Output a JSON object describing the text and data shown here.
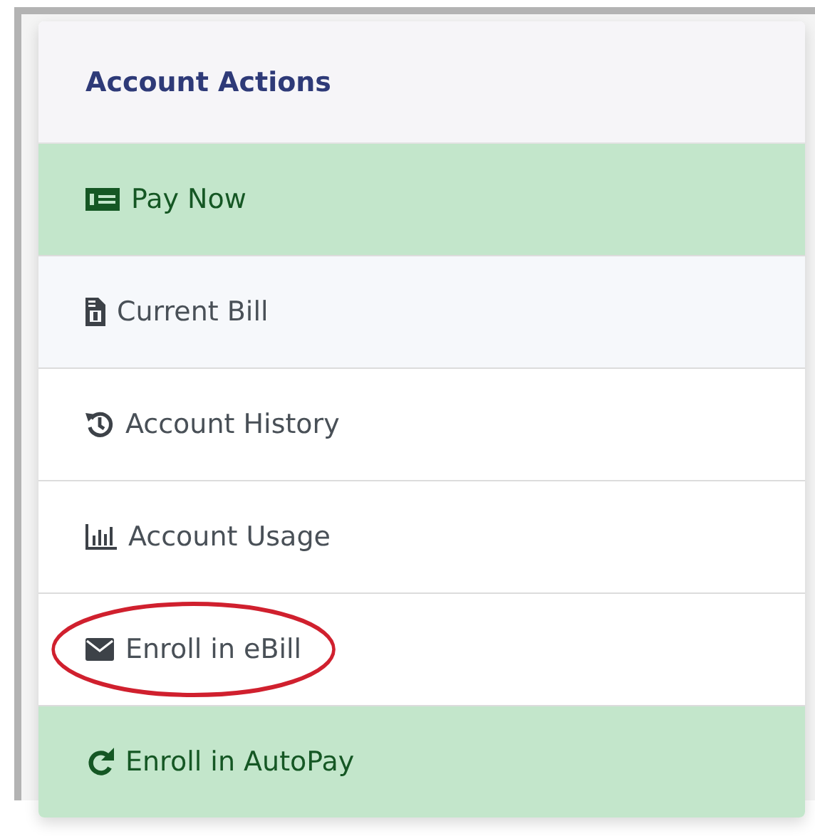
{
  "card": {
    "title": "Account Actions"
  },
  "items": [
    {
      "label": "Pay Now",
      "kind": "success",
      "circled": false
    },
    {
      "label": "Current Bill",
      "kind": "light",
      "circled": false
    },
    {
      "label": "Account History",
      "kind": "plain",
      "circled": false
    },
    {
      "label": "Account Usage",
      "kind": "plain",
      "circled": false
    },
    {
      "label": "Enroll in eBill",
      "kind": "plain",
      "circled": true
    },
    {
      "label": "Enroll in AutoPay",
      "kind": "success",
      "circled": false
    }
  ]
}
